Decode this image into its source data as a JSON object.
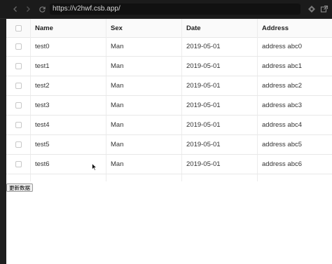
{
  "browser": {
    "url": "https://v2hwf.csb.app/",
    "icons": {
      "back": "back-arrow-icon",
      "forward": "forward-arrow-icon",
      "reload": "reload-icon",
      "puzzle": "extension-icon",
      "external": "open-external-icon"
    }
  },
  "table": {
    "columns": [
      "",
      "Name",
      "Sex",
      "Date",
      "Address"
    ],
    "rows": [
      {
        "name": "test0",
        "sex": "Man",
        "date": "2019-05-01",
        "address": "address abc0"
      },
      {
        "name": "test1",
        "sex": "Man",
        "date": "2019-05-01",
        "address": "address abc1"
      },
      {
        "name": "test2",
        "sex": "Man",
        "date": "2019-05-01",
        "address": "address abc2"
      },
      {
        "name": "test3",
        "sex": "Man",
        "date": "2019-05-01",
        "address": "address abc3"
      },
      {
        "name": "test4",
        "sex": "Man",
        "date": "2019-05-01",
        "address": "address abc4"
      },
      {
        "name": "test5",
        "sex": "Man",
        "date": "2019-05-01",
        "address": "address abc5"
      },
      {
        "name": "test6",
        "sex": "Man",
        "date": "2019-05-01",
        "address": "address abc6"
      }
    ]
  },
  "actions": {
    "update_label": "更新数据"
  }
}
